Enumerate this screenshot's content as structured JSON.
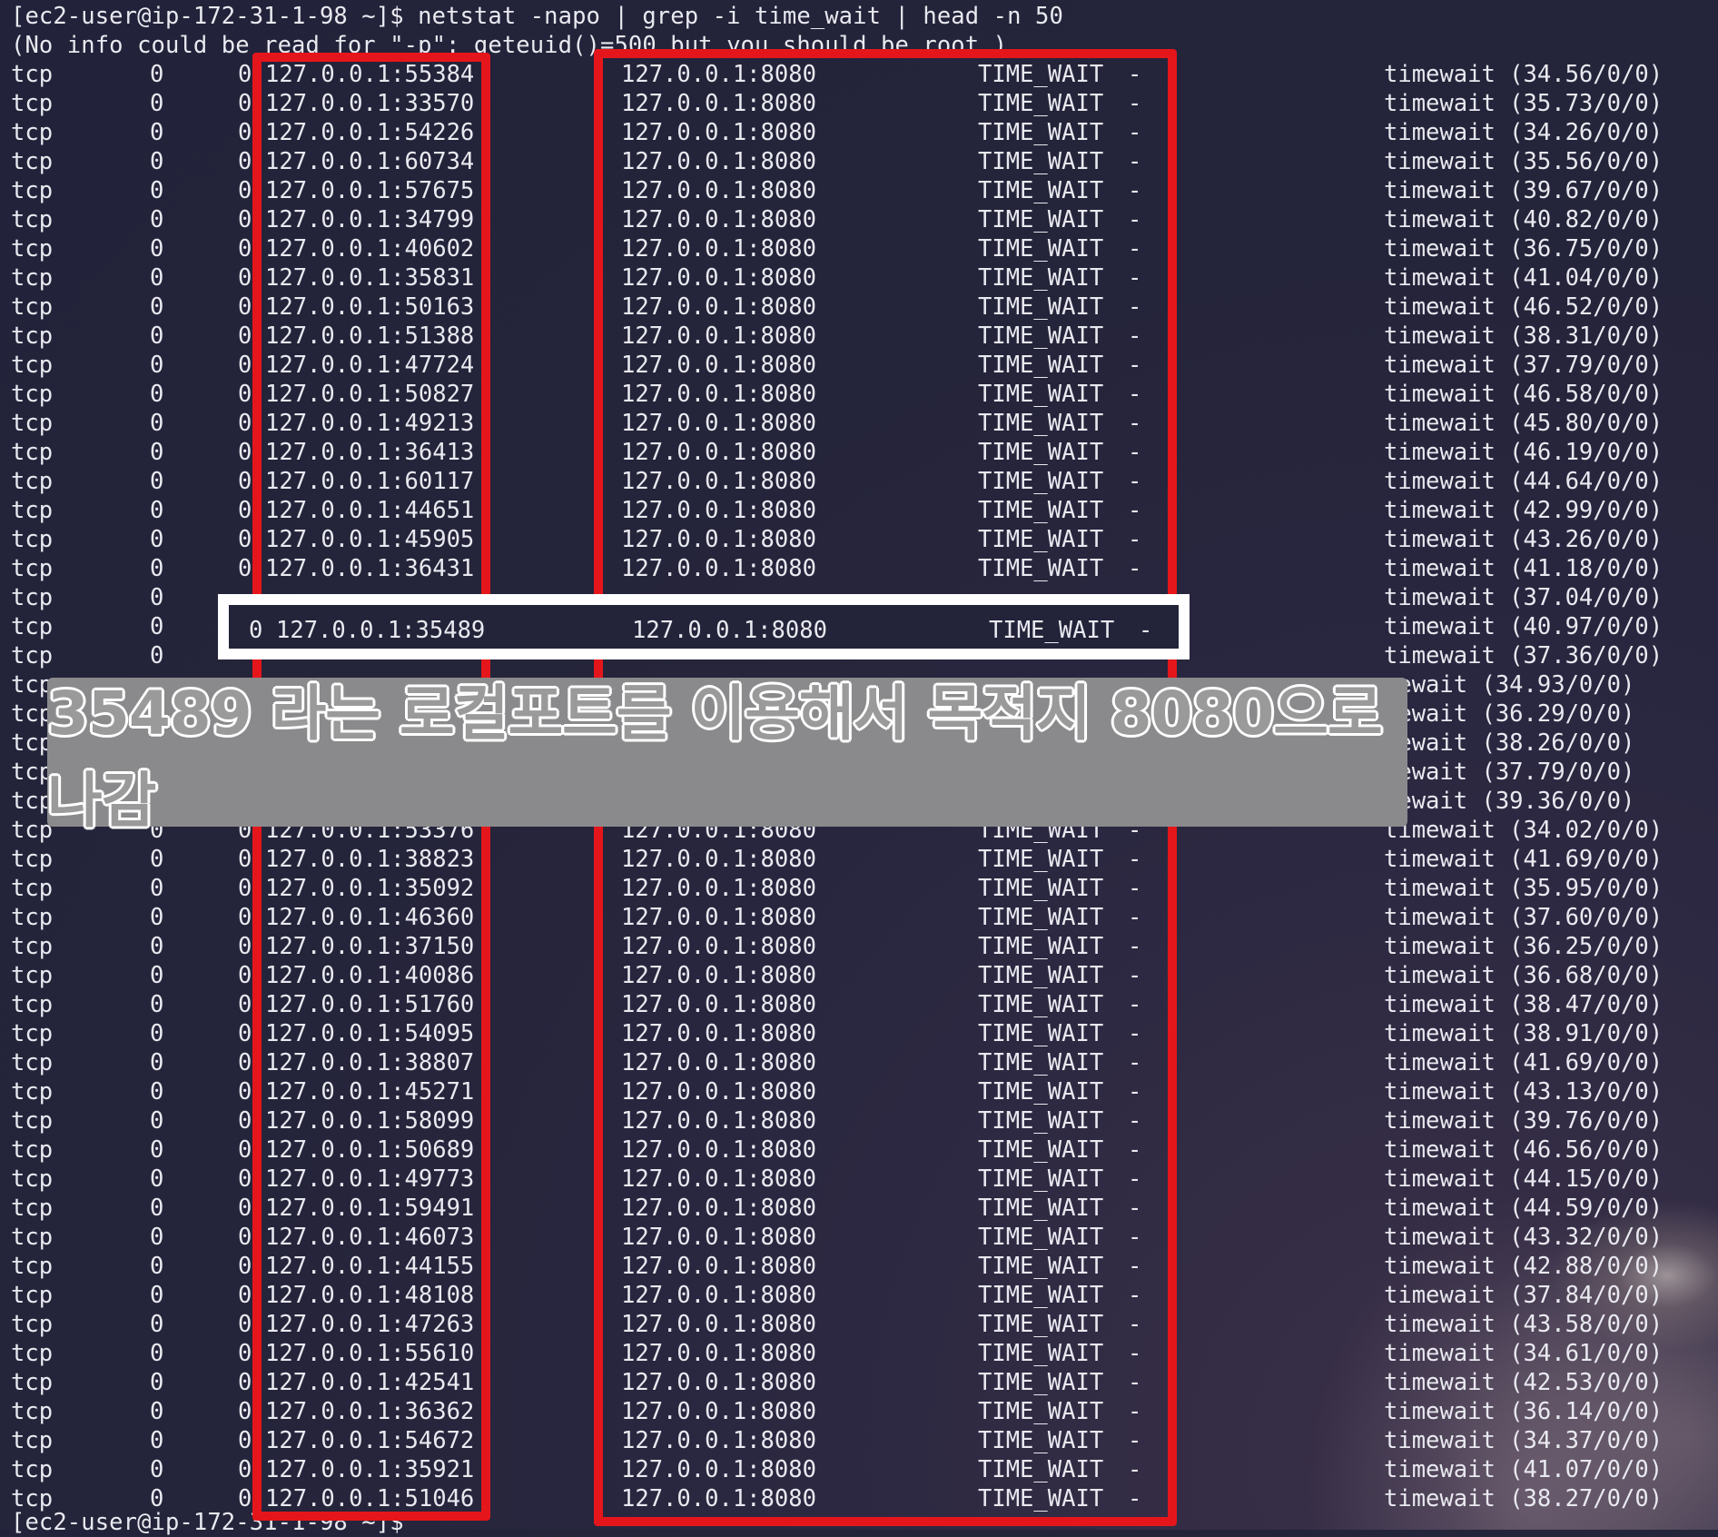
{
  "terminal": {
    "command_line": "[ec2-user@ip-172-31-1-98 ~]$ netstat -napo | grep -i time_wait | head -n 50",
    "warning_line": "(No info could be read for \"-p\": geteuid()=500 but you should be root.)",
    "final_prompt": "[ec2-user@ip-172-31-1-98 ~]$",
    "rows": [
      {
        "proto": "tcp",
        "recv": "0",
        "send": "0",
        "local": "127.0.0.1:55384",
        "foreign": "127.0.0.1:8080",
        "state": "TIME_WAIT",
        "pid": "-",
        "timer": "timewait (34.56/0/0)"
      },
      {
        "proto": "tcp",
        "recv": "0",
        "send": "0",
        "local": "127.0.0.1:33570",
        "foreign": "127.0.0.1:8080",
        "state": "TIME_WAIT",
        "pid": "-",
        "timer": "timewait (35.73/0/0)"
      },
      {
        "proto": "tcp",
        "recv": "0",
        "send": "0",
        "local": "127.0.0.1:54226",
        "foreign": "127.0.0.1:8080",
        "state": "TIME_WAIT",
        "pid": "-",
        "timer": "timewait (34.26/0/0)"
      },
      {
        "proto": "tcp",
        "recv": "0",
        "send": "0",
        "local": "127.0.0.1:60734",
        "foreign": "127.0.0.1:8080",
        "state": "TIME_WAIT",
        "pid": "-",
        "timer": "timewait (35.56/0/0)"
      },
      {
        "proto": "tcp",
        "recv": "0",
        "send": "0",
        "local": "127.0.0.1:57675",
        "foreign": "127.0.0.1:8080",
        "state": "TIME_WAIT",
        "pid": "-",
        "timer": "timewait (39.67/0/0)"
      },
      {
        "proto": "tcp",
        "recv": "0",
        "send": "0",
        "local": "127.0.0.1:34799",
        "foreign": "127.0.0.1:8080",
        "state": "TIME_WAIT",
        "pid": "-",
        "timer": "timewait (40.82/0/0)"
      },
      {
        "proto": "tcp",
        "recv": "0",
        "send": "0",
        "local": "127.0.0.1:40602",
        "foreign": "127.0.0.1:8080",
        "state": "TIME_WAIT",
        "pid": "-",
        "timer": "timewait (36.75/0/0)"
      },
      {
        "proto": "tcp",
        "recv": "0",
        "send": "0",
        "local": "127.0.0.1:35831",
        "foreign": "127.0.0.1:8080",
        "state": "TIME_WAIT",
        "pid": "-",
        "timer": "timewait (41.04/0/0)"
      },
      {
        "proto": "tcp",
        "recv": "0",
        "send": "0",
        "local": "127.0.0.1:50163",
        "foreign": "127.0.0.1:8080",
        "state": "TIME_WAIT",
        "pid": "-",
        "timer": "timewait (46.52/0/0)"
      },
      {
        "proto": "tcp",
        "recv": "0",
        "send": "0",
        "local": "127.0.0.1:51388",
        "foreign": "127.0.0.1:8080",
        "state": "TIME_WAIT",
        "pid": "-",
        "timer": "timewait (38.31/0/0)"
      },
      {
        "proto": "tcp",
        "recv": "0",
        "send": "0",
        "local": "127.0.0.1:47724",
        "foreign": "127.0.0.1:8080",
        "state": "TIME_WAIT",
        "pid": "-",
        "timer": "timewait (37.79/0/0)"
      },
      {
        "proto": "tcp",
        "recv": "0",
        "send": "0",
        "local": "127.0.0.1:50827",
        "foreign": "127.0.0.1:8080",
        "state": "TIME_WAIT",
        "pid": "-",
        "timer": "timewait (46.58/0/0)"
      },
      {
        "proto": "tcp",
        "recv": "0",
        "send": "0",
        "local": "127.0.0.1:49213",
        "foreign": "127.0.0.1:8080",
        "state": "TIME_WAIT",
        "pid": "-",
        "timer": "timewait (45.80/0/0)"
      },
      {
        "proto": "tcp",
        "recv": "0",
        "send": "0",
        "local": "127.0.0.1:36413",
        "foreign": "127.0.0.1:8080",
        "state": "TIME_WAIT",
        "pid": "-",
        "timer": "timewait (46.19/0/0)"
      },
      {
        "proto": "tcp",
        "recv": "0",
        "send": "0",
        "local": "127.0.0.1:60117",
        "foreign": "127.0.0.1:8080",
        "state": "TIME_WAIT",
        "pid": "-",
        "timer": "timewait (44.64/0/0)"
      },
      {
        "proto": "tcp",
        "recv": "0",
        "send": "0",
        "local": "127.0.0.1:44651",
        "foreign": "127.0.0.1:8080",
        "state": "TIME_WAIT",
        "pid": "-",
        "timer": "timewait (42.99/0/0)"
      },
      {
        "proto": "tcp",
        "recv": "0",
        "send": "0",
        "local": "127.0.0.1:45905",
        "foreign": "127.0.0.1:8080",
        "state": "TIME_WAIT",
        "pid": "-",
        "timer": "timewait (43.26/0/0)"
      },
      {
        "proto": "tcp",
        "recv": "0",
        "send": "0",
        "local": "127.0.0.1:36431",
        "foreign": "127.0.0.1:8080",
        "state": "TIME_WAIT",
        "pid": "-",
        "timer": "timewait (41.18/0/0)"
      },
      {
        "proto": "tcp",
        "recv": "0",
        "send": "",
        "local": "",
        "foreign": "",
        "state": "",
        "pid": "",
        "timer": "timewait (37.04/0/0)"
      },
      {
        "proto": "tcp",
        "recv": "0",
        "send": "",
        "local": "",
        "foreign": "",
        "state": "",
        "pid": "",
        "timer": "timewait (40.97/0/0)"
      },
      {
        "proto": "tcp",
        "recv": "0",
        "send": "",
        "local": "",
        "foreign": "",
        "state": "",
        "pid": "",
        "timer": "timewait (37.36/0/0)"
      },
      {
        "proto": "tcp",
        "recv": "",
        "send": "",
        "local": "",
        "foreign": "",
        "state": "",
        "pid": "",
        "timer": "mewait (34.93/0/0)"
      },
      {
        "proto": "tcp",
        "recv": "",
        "send": "",
        "local": "",
        "foreign": "",
        "state": "",
        "pid": "",
        "timer": "mewait (36.29/0/0)"
      },
      {
        "proto": "tcp",
        "recv": "",
        "send": "",
        "local": "",
        "foreign": "",
        "state": "",
        "pid": "",
        "timer": "mewait (38.26/0/0)"
      },
      {
        "proto": "tcp",
        "recv": "",
        "send": "",
        "local": "",
        "foreign": "",
        "state": "",
        "pid": "",
        "timer": "mewait (37.79/0/0)"
      },
      {
        "proto": "tcp",
        "recv": "",
        "send": "",
        "local": "",
        "foreign": "",
        "state": "",
        "pid": "",
        "timer": "mewait (39.36/0/0)"
      },
      {
        "proto": "tcp",
        "recv": "0",
        "send": "0",
        "local": "127.0.0.1:53376",
        "foreign": "127.0.0.1:8080",
        "state": "TIME_WAIT",
        "pid": "-",
        "timer": "timewait (34.02/0/0)"
      },
      {
        "proto": "tcp",
        "recv": "0",
        "send": "0",
        "local": "127.0.0.1:38823",
        "foreign": "127.0.0.1:8080",
        "state": "TIME_WAIT",
        "pid": "-",
        "timer": "timewait (41.69/0/0)"
      },
      {
        "proto": "tcp",
        "recv": "0",
        "send": "0",
        "local": "127.0.0.1:35092",
        "foreign": "127.0.0.1:8080",
        "state": "TIME_WAIT",
        "pid": "-",
        "timer": "timewait (35.95/0/0)"
      },
      {
        "proto": "tcp",
        "recv": "0",
        "send": "0",
        "local": "127.0.0.1:46360",
        "foreign": "127.0.0.1:8080",
        "state": "TIME_WAIT",
        "pid": "-",
        "timer": "timewait (37.60/0/0)"
      },
      {
        "proto": "tcp",
        "recv": "0",
        "send": "0",
        "local": "127.0.0.1:37150",
        "foreign": "127.0.0.1:8080",
        "state": "TIME_WAIT",
        "pid": "-",
        "timer": "timewait (36.25/0/0)"
      },
      {
        "proto": "tcp",
        "recv": "0",
        "send": "0",
        "local": "127.0.0.1:40086",
        "foreign": "127.0.0.1:8080",
        "state": "TIME_WAIT",
        "pid": "-",
        "timer": "timewait (36.68/0/0)"
      },
      {
        "proto": "tcp",
        "recv": "0",
        "send": "0",
        "local": "127.0.0.1:51760",
        "foreign": "127.0.0.1:8080",
        "state": "TIME_WAIT",
        "pid": "-",
        "timer": "timewait (38.47/0/0)"
      },
      {
        "proto": "tcp",
        "recv": "0",
        "send": "0",
        "local": "127.0.0.1:54095",
        "foreign": "127.0.0.1:8080",
        "state": "TIME_WAIT",
        "pid": "-",
        "timer": "timewait (38.91/0/0)"
      },
      {
        "proto": "tcp",
        "recv": "0",
        "send": "0",
        "local": "127.0.0.1:38807",
        "foreign": "127.0.0.1:8080",
        "state": "TIME_WAIT",
        "pid": "-",
        "timer": "timewait (41.69/0/0)"
      },
      {
        "proto": "tcp",
        "recv": "0",
        "send": "0",
        "local": "127.0.0.1:45271",
        "foreign": "127.0.0.1:8080",
        "state": "TIME_WAIT",
        "pid": "-",
        "timer": "timewait (43.13/0/0)"
      },
      {
        "proto": "tcp",
        "recv": "0",
        "send": "0",
        "local": "127.0.0.1:58099",
        "foreign": "127.0.0.1:8080",
        "state": "TIME_WAIT",
        "pid": "-",
        "timer": "timewait (39.76/0/0)"
      },
      {
        "proto": "tcp",
        "recv": "0",
        "send": "0",
        "local": "127.0.0.1:50689",
        "foreign": "127.0.0.1:8080",
        "state": "TIME_WAIT",
        "pid": "-",
        "timer": "timewait (46.56/0/0)"
      },
      {
        "proto": "tcp",
        "recv": "0",
        "send": "0",
        "local": "127.0.0.1:49773",
        "foreign": "127.0.0.1:8080",
        "state": "TIME_WAIT",
        "pid": "-",
        "timer": "timewait (44.15/0/0)"
      },
      {
        "proto": "tcp",
        "recv": "0",
        "send": "0",
        "local": "127.0.0.1:59491",
        "foreign": "127.0.0.1:8080",
        "state": "TIME_WAIT",
        "pid": "-",
        "timer": "timewait (44.59/0/0)"
      },
      {
        "proto": "tcp",
        "recv": "0",
        "send": "0",
        "local": "127.0.0.1:46073",
        "foreign": "127.0.0.1:8080",
        "state": "TIME_WAIT",
        "pid": "-",
        "timer": "timewait (43.32/0/0)"
      },
      {
        "proto": "tcp",
        "recv": "0",
        "send": "0",
        "local": "127.0.0.1:44155",
        "foreign": "127.0.0.1:8080",
        "state": "TIME_WAIT",
        "pid": "-",
        "timer": "timewait (42.88/0/0)"
      },
      {
        "proto": "tcp",
        "recv": "0",
        "send": "0",
        "local": "127.0.0.1:48108",
        "foreign": "127.0.0.1:8080",
        "state": "TIME_WAIT",
        "pid": "-",
        "timer": "timewait (37.84/0/0)"
      },
      {
        "proto": "tcp",
        "recv": "0",
        "send": "0",
        "local": "127.0.0.1:47263",
        "foreign": "127.0.0.1:8080",
        "state": "TIME_WAIT",
        "pid": "-",
        "timer": "timewait (43.58/0/0)"
      },
      {
        "proto": "tcp",
        "recv": "0",
        "send": "0",
        "local": "127.0.0.1:55610",
        "foreign": "127.0.0.1:8080",
        "state": "TIME_WAIT",
        "pid": "-",
        "timer": "timewait (34.61/0/0)"
      },
      {
        "proto": "tcp",
        "recv": "0",
        "send": "0",
        "local": "127.0.0.1:42541",
        "foreign": "127.0.0.1:8080",
        "state": "TIME_WAIT",
        "pid": "-",
        "timer": "timewait (42.53/0/0)"
      },
      {
        "proto": "tcp",
        "recv": "0",
        "send": "0",
        "local": "127.0.0.1:36362",
        "foreign": "127.0.0.1:8080",
        "state": "TIME_WAIT",
        "pid": "-",
        "timer": "timewait (36.14/0/0)"
      },
      {
        "proto": "tcp",
        "recv": "0",
        "send": "0",
        "local": "127.0.0.1:54672",
        "foreign": "127.0.0.1:8080",
        "state": "TIME_WAIT",
        "pid": "-",
        "timer": "timewait (34.37/0/0)"
      },
      {
        "proto": "tcp",
        "recv": "0",
        "send": "0",
        "local": "127.0.0.1:35921",
        "foreign": "127.0.0.1:8080",
        "state": "TIME_WAIT",
        "pid": "-",
        "timer": "timewait (41.07/0/0)"
      },
      {
        "proto": "tcp",
        "recv": "0",
        "send": "0",
        "local": "127.0.0.1:51046",
        "foreign": "127.0.0.1:8080",
        "state": "TIME_WAIT",
        "pid": "-",
        "timer": "timewait (38.27/0/0)"
      }
    ]
  },
  "highlight": {
    "send": "0",
    "local": "127.0.0.1:35489",
    "foreign": "127.0.0.1:8080",
    "state": "TIME_WAIT",
    "pid": "-"
  },
  "caption": {
    "text": "35489 라는 로컬포트를 이용해서 목적지 8080으로 나감"
  },
  "colors": {
    "terminal_bg": "#23233a",
    "text": "#e9e9f0",
    "annotation_red": "#e5161b",
    "annotation_white": "#ffffff",
    "caption_bg": "#8a8a8c"
  }
}
